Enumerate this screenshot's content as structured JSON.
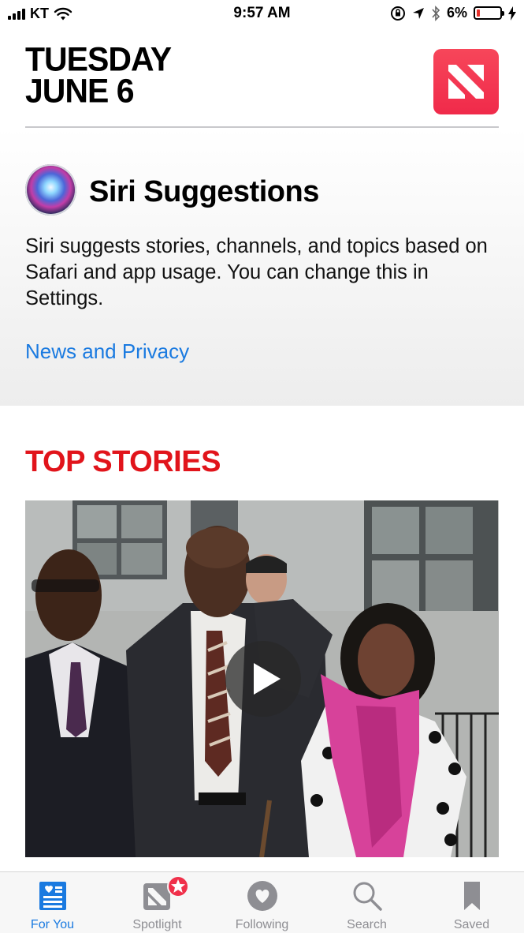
{
  "status_bar": {
    "carrier": "KT",
    "time": "9:57 AM",
    "battery": "6%",
    "battery_level": 0.06
  },
  "header": {
    "day": "TUESDAY",
    "date": "JUNE 6",
    "app_icon": "apple-news-icon"
  },
  "siri": {
    "title": "Siri Suggestions",
    "description": "Siri suggests stories, channels, and topics based on Safari and app usage. You can change this in Settings.",
    "link": "News and Privacy"
  },
  "top_stories": {
    "title": "TOP STORIES",
    "video_action": "play-icon"
  },
  "tabs": [
    {
      "label": "For You",
      "icon": "for-you-icon",
      "active": true
    },
    {
      "label": "Spotlight",
      "icon": "spotlight-icon",
      "active": false
    },
    {
      "label": "Following",
      "icon": "heart-icon",
      "active": false
    },
    {
      "label": "Search",
      "icon": "search-icon",
      "active": false
    },
    {
      "label": "Saved",
      "icon": "bookmark-icon",
      "active": false
    }
  ],
  "colors": {
    "accent": "#1a7ae0",
    "top_stories_red": "#e1141b",
    "news_brand": "#f23a52",
    "tab_inactive": "#8e8e93"
  }
}
